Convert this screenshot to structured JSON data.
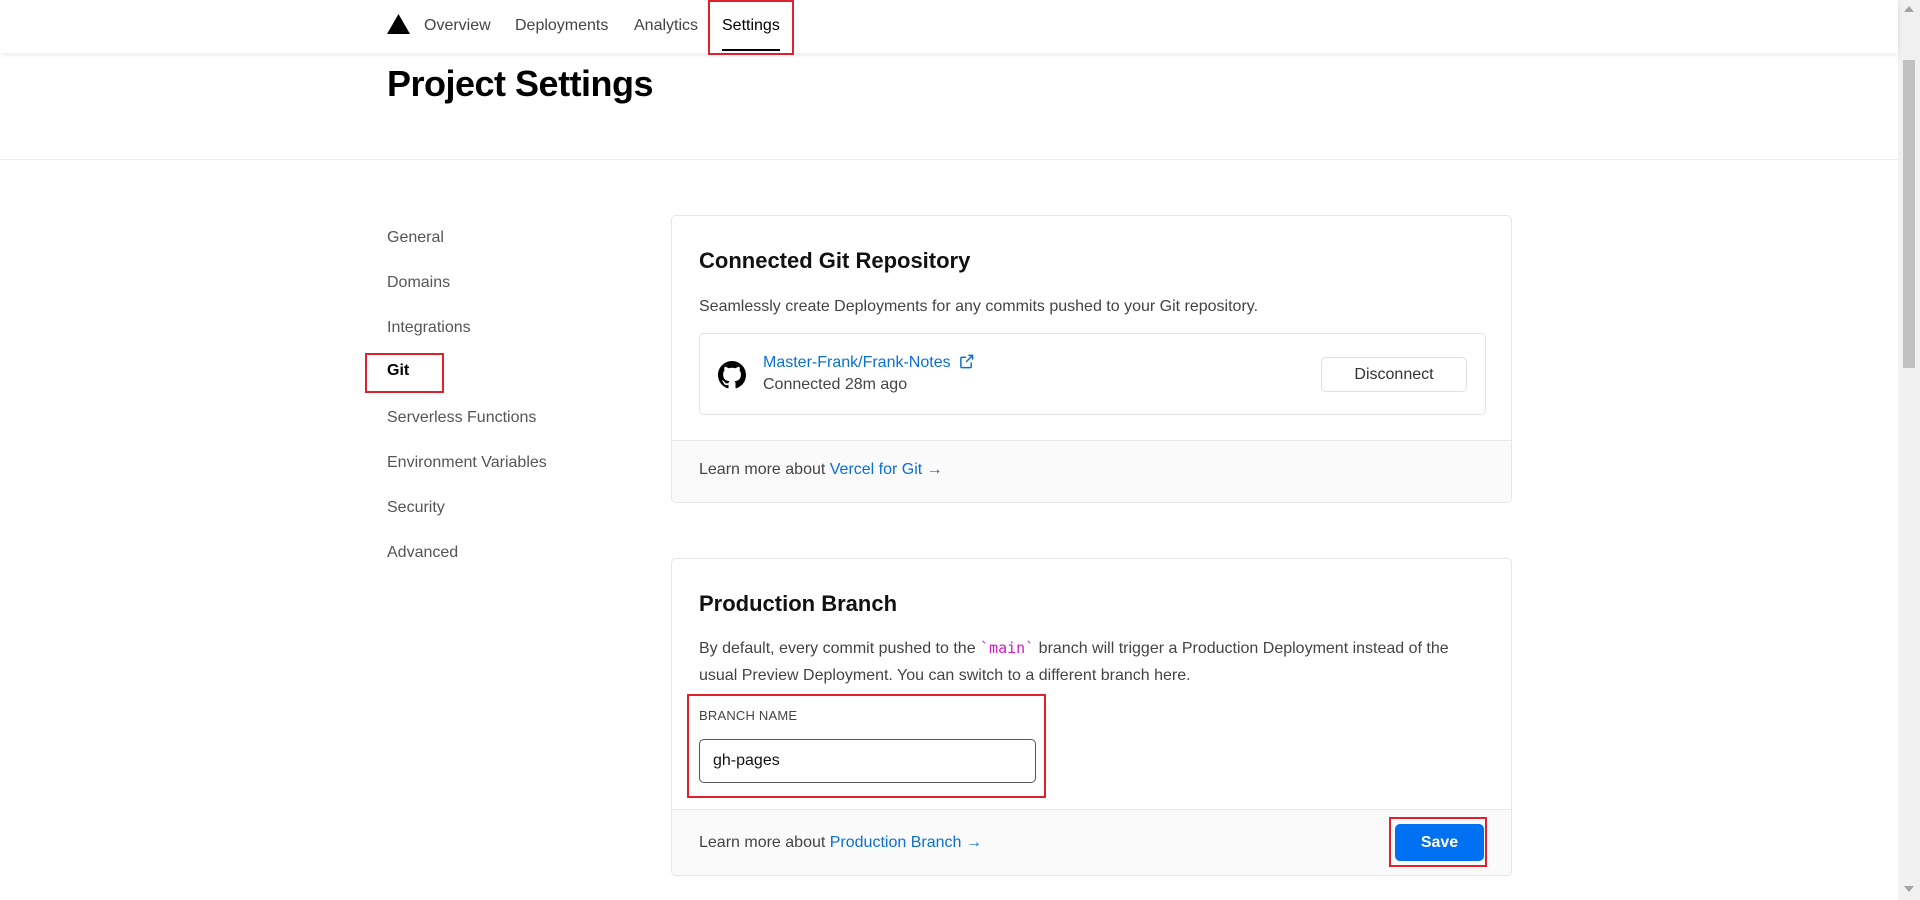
{
  "nav": {
    "logo_icon": "triangle-logo-icon",
    "items": [
      {
        "label": "Overview"
      },
      {
        "label": "Deployments"
      },
      {
        "label": "Analytics"
      },
      {
        "label": "Settings"
      }
    ],
    "active": "Settings"
  },
  "header": {
    "title": "Project Settings"
  },
  "sidebar": {
    "items": [
      {
        "label": "General"
      },
      {
        "label": "Domains"
      },
      {
        "label": "Integrations"
      },
      {
        "label": "Git"
      },
      {
        "label": "Serverless Functions"
      },
      {
        "label": "Environment Variables"
      },
      {
        "label": "Security"
      },
      {
        "label": "Advanced"
      }
    ],
    "active": "Git"
  },
  "git_card": {
    "title": "Connected Git Repository",
    "description": "Seamlessly create Deployments for any commits pushed to your Git repository.",
    "repo_icon": "github-icon",
    "repo_name": "Master-Frank/Frank-Notes",
    "external_icon": "external-link-icon",
    "status": "Connected 28m ago",
    "disconnect_label": "Disconnect",
    "footer_prefix": "Learn more about ",
    "footer_link": "Vercel for Git →"
  },
  "branch_card": {
    "title": "Production Branch",
    "desc_before": "By default, every commit pushed to the ",
    "desc_code": "`main`",
    "desc_after": " branch will trigger a Production Deployment instead of the usual Preview Deployment. You can switch to a different branch here.",
    "field_label": "BRANCH NAME",
    "branch_value": "gh-pages",
    "footer_prefix": "Learn more about ",
    "footer_link": "Production Branch →",
    "save_label": "Save"
  },
  "colors": {
    "accent": "#0070f3",
    "link": "#0a6fd6",
    "highlight": "#e0202c",
    "code": "#d418c6"
  }
}
